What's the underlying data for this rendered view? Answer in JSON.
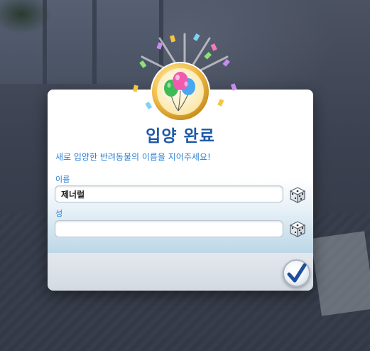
{
  "dialog": {
    "title": "입양 완료",
    "subtitle": "새로 입양한 반려동물의 이름을 지어주세요!",
    "first_name": {
      "label": "이름",
      "value": "제너럴"
    },
    "last_name": {
      "label": "성",
      "value": ""
    },
    "dice_icon": "dice-icon",
    "confirm_icon": "checkmark-icon",
    "badge_icon": "balloons-icon"
  },
  "colors": {
    "title": "#1e5aa8",
    "label": "#2a7fd6",
    "badge_gold": "#f2c14e",
    "check": "#1d4f9c"
  }
}
